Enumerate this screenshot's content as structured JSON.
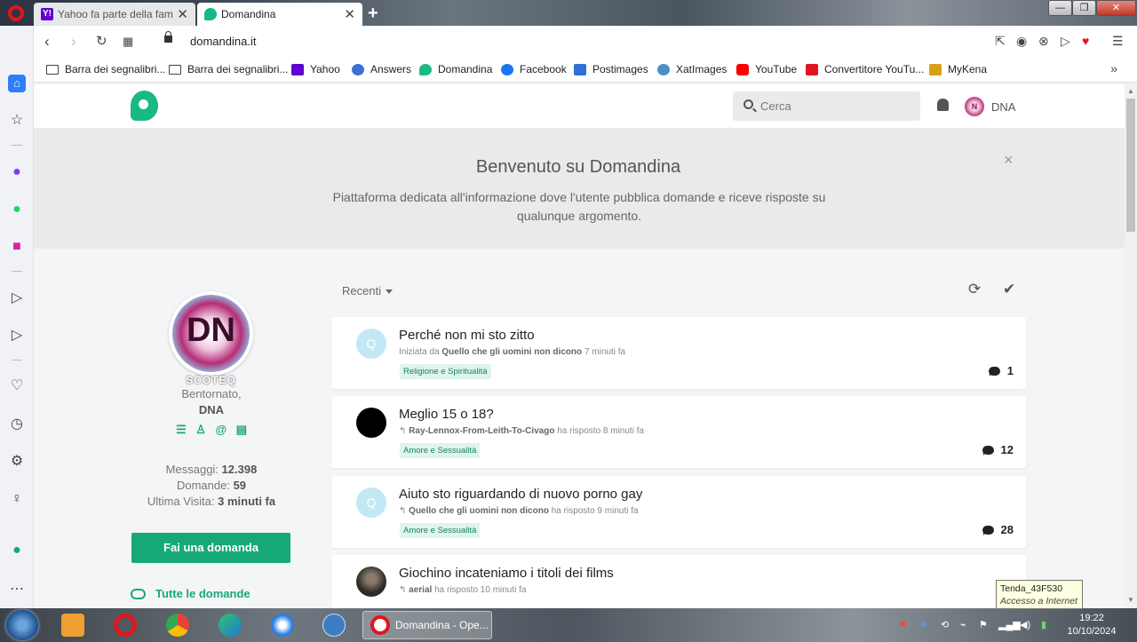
{
  "browser": {
    "tabs": [
      {
        "label": "Yahoo fa parte della famiglia",
        "active": false
      },
      {
        "label": "Domandina",
        "active": true
      }
    ],
    "new_tab": "+",
    "url": "domandina.it",
    "bookmarks": [
      {
        "label": "Barra dei segnalibri...",
        "icon": "folder-icon"
      },
      {
        "label": "Barra dei segnalibri...",
        "icon": "folder-icon"
      },
      {
        "label": "Yahoo",
        "icon": "yahoo-icon"
      },
      {
        "label": "Answers",
        "icon": "answers-icon"
      },
      {
        "label": "Domandina",
        "icon": "domandina-icon"
      },
      {
        "label": "Facebook",
        "icon": "facebook-icon"
      },
      {
        "label": "Postimages",
        "icon": "postimages-icon"
      },
      {
        "label": "XatImages",
        "icon": "xatimages-icon"
      },
      {
        "label": "YouTube",
        "icon": "youtube-icon"
      },
      {
        "label": "Convertitore YouTu...",
        "icon": "converter-icon"
      },
      {
        "label": "MyKena",
        "icon": "mykena-icon"
      }
    ]
  },
  "site": {
    "search_placeholder": "Cerca",
    "user": "DNA",
    "avatar_small_text": "N",
    "welcome": {
      "title": "Benvenuto su Domandina",
      "text": "Piattaforma dedicata all'informazione dove l'utente pubblica domande e riceve risposte su qualunque argomento.",
      "close": "×"
    },
    "profile": {
      "avatar_text": "DN",
      "avatar_sub": "SCOTEQ",
      "greeting": "Bentornato,",
      "name": "DNA",
      "messages_label": "Messaggi:",
      "messages_value": "12.398",
      "questions_label": "Domande:",
      "questions_value": "59",
      "last_visit_label": "Ultima Visita:",
      "last_visit_value": "3 minuti fa",
      "ask_button": "Fai una domanda",
      "all_questions": "Tutte le domande"
    },
    "feed": {
      "sort_label": "Recenti",
      "items": [
        {
          "avatar": "Q",
          "avatar_style": "q",
          "title": "Perché non mi sto zitto",
          "meta_prefix": "Iniziata da",
          "author": "Quello che gli uomini non dicono",
          "time": "7 minuti fa",
          "tag": "Religione e Spiritualità",
          "count": "1"
        },
        {
          "avatar": "",
          "avatar_style": "black",
          "title": "Meglio 15 o 18?",
          "meta_prefix": "↰",
          "author": "Ray-Lennox-From-Leith-To-Civago",
          "time": "ha risposto 8 minuti fa",
          "tag": "Amore e Sessualità",
          "count": "12"
        },
        {
          "avatar": "Q",
          "avatar_style": "q",
          "title": "Aiuto sto riguardando di nuovo porno gay",
          "meta_prefix": "↰",
          "author": "Quello che gli uomini non dicono",
          "time": "ha risposto 9 minuti fa",
          "tag": "Amore e Sessualità",
          "count": "28"
        },
        {
          "avatar": "",
          "avatar_style": "photo",
          "title": "Giochino incateniamo i titoli dei films",
          "meta_prefix": "↰",
          "author": "aerial",
          "time": "ha risposto 10 minuti fa",
          "tag": "",
          "count": ""
        }
      ]
    }
  },
  "tooltip": {
    "line1": "Tenda_43F530",
    "line2": "Accesso a Internet"
  },
  "taskbar": {
    "active_task": "Domandina - Ope...",
    "time": "19:22",
    "date": "10/10/2024"
  },
  "colors": {
    "accent": "#17a87a",
    "brand": "#17b985",
    "tag_bg": "#dff4ec"
  }
}
